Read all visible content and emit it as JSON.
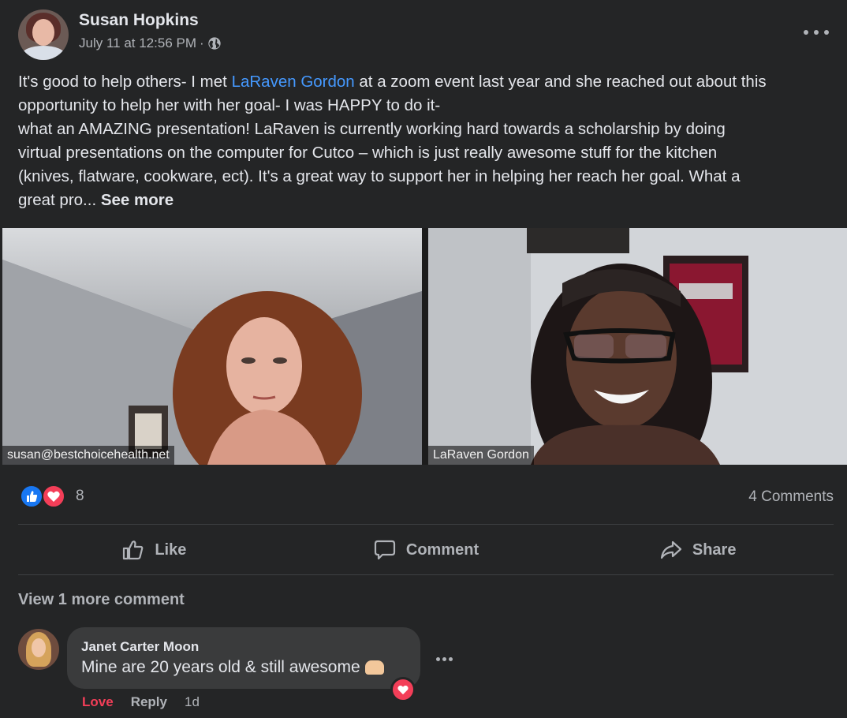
{
  "post": {
    "author": "Susan Hopkins",
    "timestamp": "July 11 at 12:56 PM",
    "meta_separator": "·",
    "privacy_icon": "globe-icon",
    "text": {
      "line1_before": "It's good to help others- I met ",
      "mention": "LaRaven Gordon",
      "line1_after": " at a zoom event last year and she reached out about this",
      "line2": "opportunity to help her with her goal- I was HAPPY to do it-",
      "line3": "what an AMAZING presentation!  LaRaven is currently working hard towards a scholarship by doing",
      "line4": "virtual presentations on the computer for Cutco  – which is just really awesome stuff for the kitchen",
      "line5": "(knives, flatware, cookware, ect).  It's a great way to support her in helping her reach her goal.  What a",
      "line6": "great pro... ",
      "see_more": "See more"
    },
    "video_tiles": [
      {
        "label": "susan@bestchoicehealth.net"
      },
      {
        "label": "LaRaven Gordon"
      }
    ],
    "reactions": {
      "icons": [
        "like-icon",
        "love-icon"
      ],
      "count": "8"
    },
    "comments_count": "4 Comments",
    "actions": {
      "like": "Like",
      "comment": "Comment",
      "share": "Share"
    },
    "view_more_comments": "View 1 more comment"
  },
  "comment": {
    "author": "Janet Carter Moon",
    "text": "Mine are 20 years old & still awesome",
    "emoji": "raising-hands-emoji",
    "reaction_icon": "love-icon",
    "love_label": "Love",
    "reply_label": "Reply",
    "time": "1d"
  },
  "colors": {
    "background": "#242526",
    "bubble": "#3a3b3c",
    "link": "#4599ff",
    "like_blue": "#1877f2",
    "love_red": "#f33e58",
    "secondary_text": "#b0b3b8"
  }
}
